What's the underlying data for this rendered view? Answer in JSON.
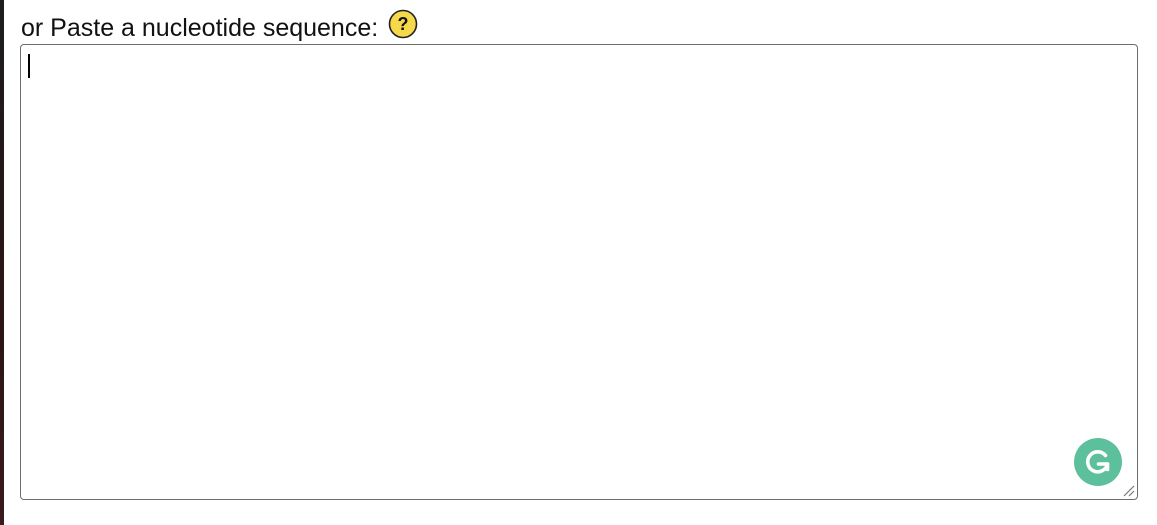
{
  "label": {
    "text": "or Paste a nucleotide sequence:"
  },
  "help": {
    "icon": "help-question-icon",
    "glyph": "?",
    "color": "#f5d94a"
  },
  "sequence_input": {
    "value": "",
    "placeholder": ""
  },
  "grammarly": {
    "icon": "grammarly-g-icon",
    "color": "#5cc09c"
  }
}
